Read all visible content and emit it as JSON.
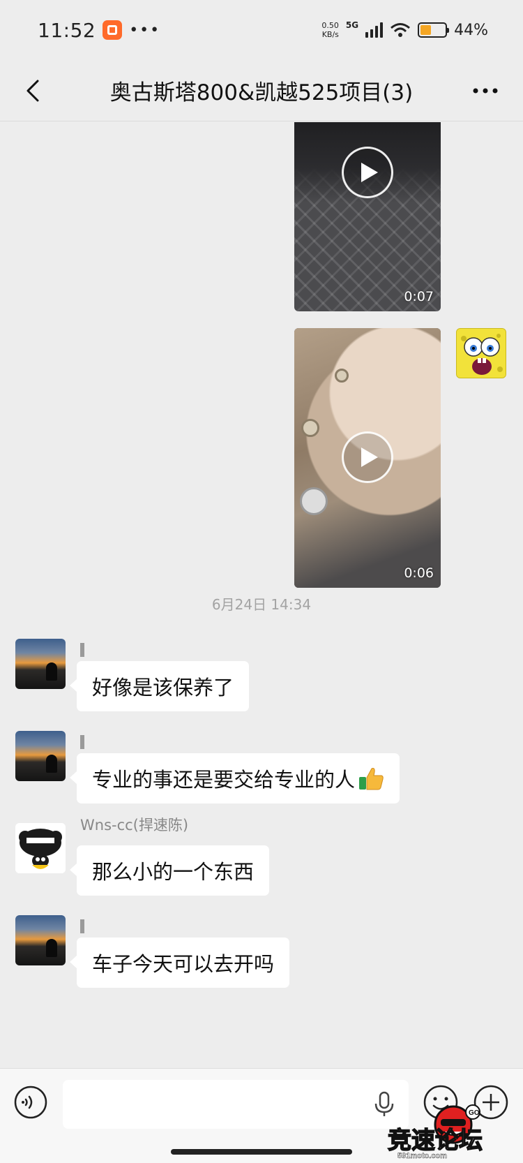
{
  "status_bar": {
    "time": "11:52",
    "net_speed_value": "0.50",
    "net_speed_unit": "KB/s",
    "network": "5G",
    "battery_percent": "44%",
    "battery_level": 0.44
  },
  "header": {
    "title": "奥古斯塔800&凯越525项目(3)"
  },
  "videos": [
    {
      "duration": "0:07"
    },
    {
      "duration": "0:06"
    }
  ],
  "timestamp": "6月24日 14:34",
  "messages": [
    {
      "sender": "",
      "text": "好像是该保养了"
    },
    {
      "sender": "",
      "text": "专业的事还是要交给专业的人"
    },
    {
      "sender": "Wns-cc(捍速陈)",
      "text": "那么小的一个东西"
    },
    {
      "sender": "",
      "text": "车子今天可以去开吗"
    }
  ],
  "input": {
    "value": "",
    "placeholder": ""
  },
  "watermark": {
    "title": "竞速论坛",
    "url": "591moto.com"
  },
  "colors": {
    "background": "#ededed",
    "bubble": "#ffffff",
    "badge": "#ff6a2a",
    "battery": "#f5a623"
  }
}
